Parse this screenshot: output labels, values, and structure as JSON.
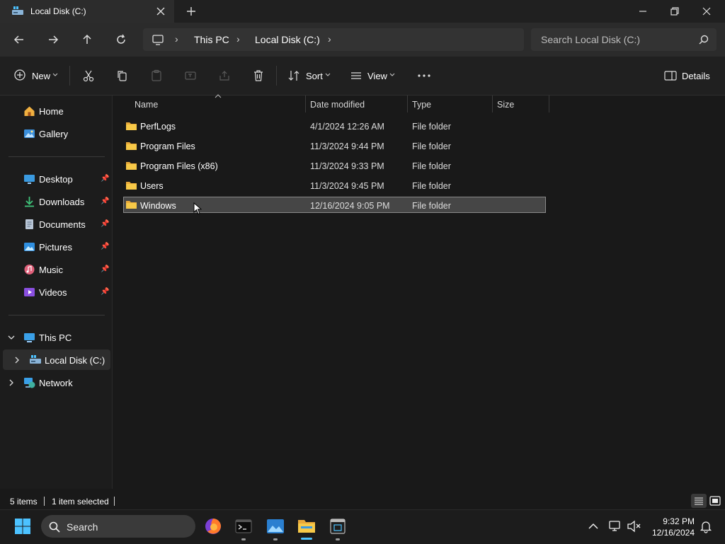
{
  "window": {
    "tab_title": "Local Disk (C:)"
  },
  "address": {
    "crumbs": [
      "This PC",
      "Local Disk (C:)"
    ],
    "search_placeholder": "Search Local Disk (C:)"
  },
  "commands": {
    "new": "New",
    "sort": "Sort",
    "view": "View",
    "details": "Details"
  },
  "sidebar": {
    "quick": [
      {
        "label": "Home",
        "icon": "home-icon"
      },
      {
        "label": "Gallery",
        "icon": "gallery-icon"
      }
    ],
    "pinned": [
      {
        "label": "Desktop",
        "icon": "desktop-icon"
      },
      {
        "label": "Downloads",
        "icon": "downloads-icon"
      },
      {
        "label": "Documents",
        "icon": "documents-icon"
      },
      {
        "label": "Pictures",
        "icon": "pictures-icon"
      },
      {
        "label": "Music",
        "icon": "music-icon"
      },
      {
        "label": "Videos",
        "icon": "videos-icon"
      }
    ],
    "tree": [
      {
        "label": "This PC",
        "icon": "computer-icon"
      },
      {
        "label": "Local Disk (C:)",
        "icon": "drive-icon"
      },
      {
        "label": "Network",
        "icon": "network-icon"
      }
    ]
  },
  "columns": [
    "Name",
    "Date modified",
    "Type",
    "Size"
  ],
  "files": [
    {
      "name": "PerfLogs",
      "date": "4/1/2024 12:26 AM",
      "type": "File folder"
    },
    {
      "name": "Program Files",
      "date": "11/3/2024 9:44 PM",
      "type": "File folder"
    },
    {
      "name": "Program Files (x86)",
      "date": "11/3/2024 9:33 PM",
      "type": "File folder"
    },
    {
      "name": "Users",
      "date": "11/3/2024 9:45 PM",
      "type": "File folder"
    },
    {
      "name": "Windows",
      "date": "12/16/2024 9:05 PM",
      "type": "File folder"
    }
  ],
  "status": {
    "count": "5 items",
    "selected": "1 item selected"
  },
  "taskbar": {
    "search": "Search",
    "time": "9:32 PM",
    "date": "12/16/2024"
  },
  "colors": {
    "folder": "#f4c542",
    "accent": "#4cc2ff"
  }
}
